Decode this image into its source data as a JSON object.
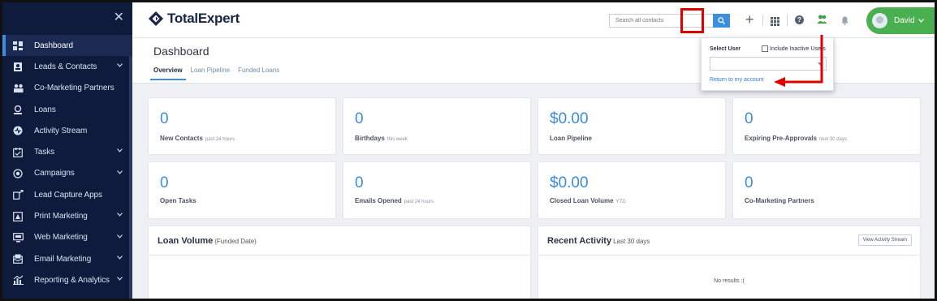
{
  "app": {
    "logo_text": "TotalExpert"
  },
  "sidebar": {
    "items": [
      {
        "label": "Dashboard",
        "icon": "dashboard-icon",
        "active": true,
        "expandable": false
      },
      {
        "label": "Leads & Contacts",
        "icon": "contacts-icon",
        "expandable": true
      },
      {
        "label": "Co-Marketing Partners",
        "icon": "partners-icon",
        "expandable": false
      },
      {
        "label": "Loans",
        "icon": "loans-icon",
        "expandable": false
      },
      {
        "label": "Activity Stream",
        "icon": "activity-icon",
        "expandable": false
      },
      {
        "label": "Tasks",
        "icon": "tasks-icon",
        "expandable": true
      },
      {
        "label": "Campaigns",
        "icon": "campaigns-icon",
        "expandable": true
      },
      {
        "label": "Lead Capture Apps",
        "icon": "lead-capture-icon",
        "expandable": false
      },
      {
        "label": "Print Marketing",
        "icon": "print-icon",
        "expandable": true
      },
      {
        "label": "Web Marketing",
        "icon": "web-icon",
        "expandable": true
      },
      {
        "label": "Email Marketing",
        "icon": "email-icon",
        "expandable": true
      },
      {
        "label": "Reporting & Analytics",
        "icon": "reporting-icon",
        "expandable": true
      }
    ]
  },
  "topbar": {
    "search_placeholder": "Search all contacts",
    "user_name": "David"
  },
  "page": {
    "title": "Dashboard",
    "tabs": [
      {
        "label": "Overview",
        "active": true
      },
      {
        "label": "Loan Pipeline",
        "active": false
      },
      {
        "label": "Funded Loans",
        "active": false
      }
    ]
  },
  "stats": [
    {
      "value": "0",
      "label": "New Contacts",
      "sub": "past 24 hours"
    },
    {
      "value": "0",
      "label": "Birthdays",
      "sub": "this week"
    },
    {
      "value": "$0.00",
      "label": "Loan Pipeline",
      "sub": ""
    },
    {
      "value": "0",
      "label": "Expiring Pre-Approvals",
      "sub": "next 30 days"
    },
    {
      "value": "0",
      "label": "Open Tasks",
      "sub": ""
    },
    {
      "value": "0",
      "label": "Emails Opened",
      "sub": "past 24 hours"
    },
    {
      "value": "$0.00",
      "label": "Closed Loan Volume",
      "sub": "YTD"
    },
    {
      "value": "0",
      "label": "Co-Marketing Partners",
      "sub": ""
    }
  ],
  "loan_volume": {
    "title": "Loan Volume",
    "sub": "(Funded Date)"
  },
  "recent_activity": {
    "title": "Recent Activity",
    "sub": "Last 30 days",
    "button": "View Activity Stream",
    "empty": "No results :("
  },
  "user_popover": {
    "select_label": "Select User",
    "include_inactive": "Include Inactive Users",
    "return_link": "Return to my account"
  },
  "colors": {
    "sidebar_bg": "#0e1b3d",
    "accent": "#3a8de0",
    "user_green": "#4ab04f",
    "highlight_red": "#e00000"
  }
}
